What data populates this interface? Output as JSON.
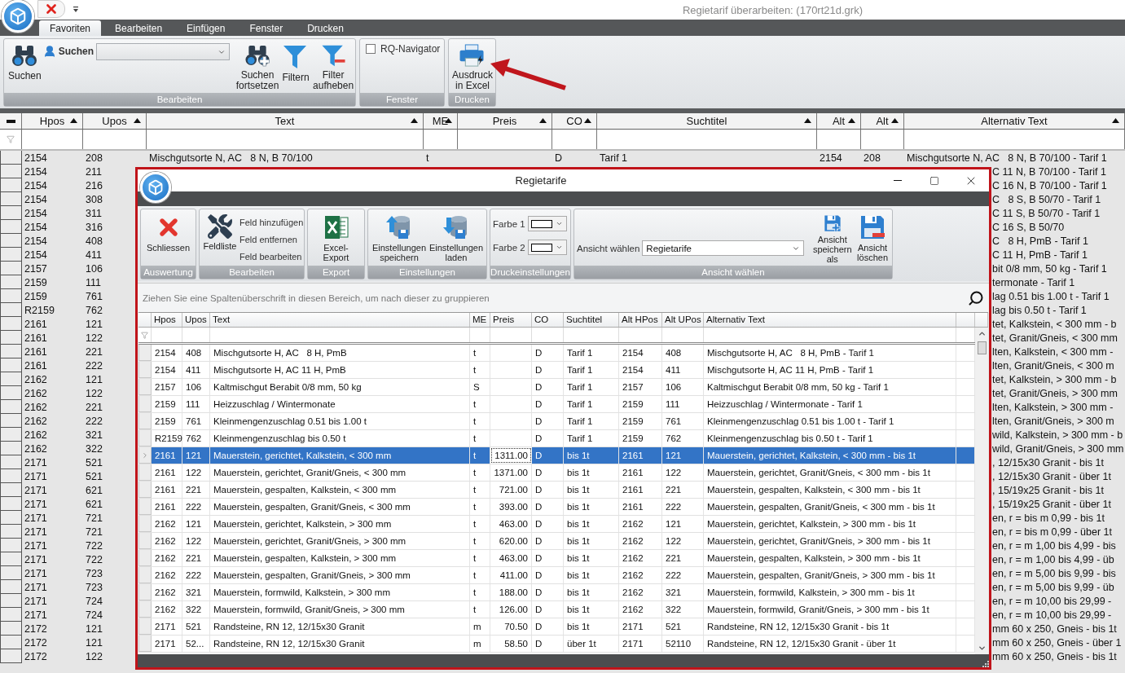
{
  "app": {
    "title": "Regietarif überarbeiten:  (170rt21d.grk)",
    "tabs": [
      {
        "label": "Favoriten",
        "selected": true
      },
      {
        "label": "Bearbeiten",
        "selected": false
      },
      {
        "label": "Einfügen",
        "selected": false
      },
      {
        "label": "Fenster",
        "selected": false
      },
      {
        "label": "Drucken",
        "selected": false
      }
    ],
    "ribbon": {
      "bearbeiten": {
        "label": "Bearbeiten",
        "search_button": "Suchen",
        "search_label": "Suchen",
        "continue_button": "Suchen fortsetzen",
        "filter_button": "Filtern",
        "clear_filter_button": "Filter aufheben"
      },
      "fenster": {
        "label": "Fenster",
        "navigator": {
          "label": "RQ-Navigator",
          "checked": false
        }
      },
      "drucken": {
        "label": "Drucken",
        "excel_button": "Ausdruck in Excel"
      }
    }
  },
  "grid": {
    "columns": [
      "Hpos",
      "Upos",
      "Text",
      "ME",
      "Preis",
      "CO",
      "Suchtitel",
      "Alt",
      "Alt",
      "Alternativ Text"
    ],
    "rows": [
      {
        "kind": "full",
        "hpos": "2154",
        "upos": "208",
        "text": "Mischgutsorte N, AC   8 N, B 70/100",
        "me": "t",
        "co": "D",
        "suchtitel": "Tarif 1",
        "alt_hpos": "2154",
        "alt_upos": "208",
        "alt_text": "Mischgutsorte N, AC   8 N, B 70/100 - Tarif 1"
      },
      {
        "kind": "covered",
        "hpos": "2154",
        "upos": "211",
        "alt_text": "C 11 N, B 70/100 - Tarif 1"
      },
      {
        "kind": "covered",
        "hpos": "2154",
        "upos": "216",
        "alt_text": "C 16 N, B 70/100 - Tarif 1"
      },
      {
        "kind": "covered",
        "hpos": "2154",
        "upos": "308",
        "alt_text": "C   8 S, B 50/70 - Tarif 1"
      },
      {
        "kind": "covered",
        "hpos": "2154",
        "upos": "311",
        "alt_text": "C 11 S, B 50/70 - Tarif 1"
      },
      {
        "kind": "covered",
        "hpos": "2154",
        "upos": "316",
        "alt_text": "C 16 S, B 50/70"
      },
      {
        "kind": "covered",
        "hpos": "2154",
        "upos": "408",
        "alt_text": "C   8 H, PmB - Tarif 1"
      },
      {
        "kind": "covered",
        "hpos": "2154",
        "upos": "411",
        "alt_text": "C 11 H, PmB - Tarif 1"
      },
      {
        "kind": "covered",
        "hpos": "2157",
        "upos": "106",
        "alt_text": "bit 0/8 mm, 50 kg - Tarif 1"
      },
      {
        "kind": "covered",
        "hpos": "2159",
        "upos": "111",
        "alt_text": "termonate - Tarif 1"
      },
      {
        "kind": "covered",
        "hpos": "2159",
        "upos": "761",
        "alt_text": "lag 0.51 bis 1.00 t - Tarif 1"
      },
      {
        "kind": "covered",
        "hpos": "R2159",
        "upos": "762",
        "alt_text": "lag bis 0.50 t - Tarif 1"
      },
      {
        "kind": "covered",
        "hpos": "2161",
        "upos": "121",
        "alt_text": "tet, Kalkstein, < 300 mm - b"
      },
      {
        "kind": "covered",
        "hpos": "2161",
        "upos": "122",
        "alt_text": "tet, Granit/Gneis, < 300 mm"
      },
      {
        "kind": "covered",
        "hpos": "2161",
        "upos": "221",
        "alt_text": "lten, Kalkstein, < 300 mm -"
      },
      {
        "kind": "covered",
        "hpos": "2161",
        "upos": "222",
        "alt_text": "lten, Granit/Gneis, < 300 m"
      },
      {
        "kind": "covered",
        "hpos": "2162",
        "upos": "121",
        "alt_text": "tet, Kalkstein, > 300 mm - b"
      },
      {
        "kind": "covered",
        "hpos": "2162",
        "upos": "122",
        "alt_text": "tet, Granit/Gneis, > 300 mm"
      },
      {
        "kind": "covered",
        "hpos": "2162",
        "upos": "221",
        "alt_text": "lten, Kalkstein, > 300 mm -"
      },
      {
        "kind": "covered",
        "hpos": "2162",
        "upos": "222",
        "alt_text": "lten, Granit/Gneis, > 300 m"
      },
      {
        "kind": "covered",
        "hpos": "2162",
        "upos": "321",
        "alt_text": "wild, Kalkstein, > 300 mm - b"
      },
      {
        "kind": "covered",
        "hpos": "2162",
        "upos": "322",
        "alt_text": "wild, Granit/Gneis, > 300 mm"
      },
      {
        "kind": "covered",
        "hpos": "2171",
        "upos": "521",
        "alt_text": ", 12/15x30 Granit - bis 1t"
      },
      {
        "kind": "covered",
        "hpos": "2171",
        "upos": "521",
        "alt_text": ", 12/15x30 Granit - über 1t"
      },
      {
        "kind": "covered",
        "hpos": "2171",
        "upos": "621",
        "alt_text": ", 15/19x25 Granit - bis 1t"
      },
      {
        "kind": "covered",
        "hpos": "2171",
        "upos": "621",
        "alt_text": ", 15/19x25 Granit - über 1t"
      },
      {
        "kind": "covered",
        "hpos": "2171",
        "upos": "721",
        "alt_text": "en, r = bis m 0,99 - bis 1t"
      },
      {
        "kind": "covered",
        "hpos": "2171",
        "upos": "721",
        "alt_text": "en, r = bis m 0,99 - über 1t"
      },
      {
        "kind": "covered",
        "hpos": "2171",
        "upos": "722",
        "alt_text": "en, r = m 1,00 bis 4,99 - bis"
      },
      {
        "kind": "covered",
        "hpos": "2171",
        "upos": "722",
        "alt_text": "en, r = m 1,00 bis 4,99 - üb"
      },
      {
        "kind": "covered",
        "hpos": "2171",
        "upos": "723",
        "alt_text": "en, r = m 5,00 bis 9,99 - bis"
      },
      {
        "kind": "covered",
        "hpos": "2171",
        "upos": "723",
        "alt_text": "en, r = m 5,00 bis 9,99 - üb"
      },
      {
        "kind": "covered",
        "hpos": "2171",
        "upos": "724",
        "alt_text": "en, r = m 10,00 bis 29,99 -"
      },
      {
        "kind": "covered",
        "hpos": "2171",
        "upos": "724",
        "alt_text": "en, r = m 10,00 bis 29,99 -"
      },
      {
        "kind": "covered",
        "hpos": "2172",
        "upos": "121",
        "alt_text": "mm 60 x 250, Gneis - bis 1t"
      },
      {
        "kind": "covered",
        "hpos": "2172",
        "upos": "121",
        "alt_text": "mm 60 x 250, Gneis - über 1"
      },
      {
        "kind": "covered",
        "hpos": "2172",
        "upos": "122",
        "alt_text": "mm 60 x 250, Gneis - bis 1t"
      }
    ]
  },
  "window": {
    "title": "Regietarife",
    "ribbon": {
      "auswertung": {
        "label": "Auswertung",
        "close_button": "Schliessen"
      },
      "bearbeiten": {
        "label": "Bearbeiten",
        "fields_button": "Feldliste",
        "items": [
          "Feld hinzufügen",
          "Feld entfernen",
          "Feld bearbeiten"
        ]
      },
      "export": {
        "label": "Export",
        "excel_button": "Excel-Export"
      },
      "einstellungen": {
        "label": "Einstellungen",
        "save_button": "Einstellungen speichern",
        "load_button": "Einstellungen laden"
      },
      "druck": {
        "label": "Druckeinstellungen",
        "colors": [
          "Farbe 1",
          "Farbe 2"
        ]
      },
      "ansicht": {
        "label": "Ansicht wählen",
        "view_label": "Ansicht wählen",
        "view_value": "Regietarife",
        "save_as_button": "Ansicht speichern als",
        "delete_button": "Ansicht löschen"
      }
    },
    "group_hint": "Ziehen Sie eine Spaltenüberschrift in diesen Bereich, um nach dieser zu gruppieren",
    "columns": [
      "Hpos",
      "Upos",
      "Text",
      "ME",
      "Preis",
      "CO",
      "Suchtitel",
      "Alt HPos",
      "Alt UPos",
      "Alternativ Text"
    ],
    "rows": [
      {
        "hpos": "2154",
        "upos": "408",
        "text": "Mischgutsorte H, AC   8 H, PmB",
        "me": "t",
        "co": "D",
        "suchtitel": "Tarif 1",
        "alt_hpos": "2154",
        "alt_upos": "408",
        "alt_text": "Mischgutsorte H, AC   8 H, PmB - Tarif 1",
        "selected": false
      },
      {
        "hpos": "2154",
        "upos": "411",
        "text": "Mischgutsorte H, AC 11 H, PmB",
        "me": "t",
        "co": "D",
        "suchtitel": "Tarif 1",
        "alt_hpos": "2154",
        "alt_upos": "411",
        "alt_text": "Mischgutsorte H, AC 11 H, PmB - Tarif 1",
        "selected": false
      },
      {
        "hpos": "2157",
        "upos": "106",
        "text": "Kaltmischgut Berabit 0/8 mm, 50 kg",
        "me": "S",
        "co": "D",
        "suchtitel": "Tarif 1",
        "alt_hpos": "2157",
        "alt_upos": "106",
        "alt_text": "Kaltmischgut Berabit 0/8 mm, 50 kg - Tarif 1",
        "selected": false
      },
      {
        "hpos": "2159",
        "upos": "111",
        "text": "Heizzuschlag / Wintermonate",
        "me": "t",
        "co": "D",
        "suchtitel": "Tarif 1",
        "alt_hpos": "2159",
        "alt_upos": "111",
        "alt_text": "Heizzuschlag / Wintermonate - Tarif 1",
        "selected": false
      },
      {
        "hpos": "2159",
        "upos": "761",
        "text": "Kleinmengenzuschlag 0.51 bis 1.00 t",
        "me": "t",
        "co": "D",
        "suchtitel": "Tarif 1",
        "alt_hpos": "2159",
        "alt_upos": "761",
        "alt_text": "Kleinmengenzuschlag 0.51 bis 1.00 t - Tarif 1",
        "selected": false
      },
      {
        "hpos": "R2159",
        "upos": "762",
        "text": "Kleinmengenzuschlag bis 0.50 t",
        "me": "t",
        "co": "D",
        "suchtitel": "Tarif 1",
        "alt_hpos": "2159",
        "alt_upos": "762",
        "alt_text": "Kleinmengenzuschlag bis 0.50 t - Tarif 1",
        "selected": false
      },
      {
        "hpos": "2161",
        "upos": "121",
        "text": "Mauerstein, gerichtet, Kalkstein, < 300 mm",
        "me": "t",
        "preis": "1311.00",
        "co": "D",
        "suchtitel": "bis 1t",
        "alt_hpos": "2161",
        "alt_upos": "121",
        "alt_text": "Mauerstein, gerichtet, Kalkstein, < 300 mm - bis 1t",
        "selected": true
      },
      {
        "hpos": "2161",
        "upos": "122",
        "text": "Mauerstein, gerichtet, Granit/Gneis, < 300 mm",
        "me": "t",
        "preis": "1371.00",
        "co": "D",
        "suchtitel": "bis 1t",
        "alt_hpos": "2161",
        "alt_upos": "122",
        "alt_text": "Mauerstein, gerichtet, Granit/Gneis, < 300 mm - bis 1t",
        "selected": false
      },
      {
        "hpos": "2161",
        "upos": "221",
        "text": "Mauerstein, gespalten, Kalkstein, < 300 mm",
        "me": "t",
        "preis": "721.00",
        "co": "D",
        "suchtitel": "bis 1t",
        "alt_hpos": "2161",
        "alt_upos": "221",
        "alt_text": "Mauerstein, gespalten, Kalkstein, < 300 mm - bis 1t",
        "selected": false
      },
      {
        "hpos": "2161",
        "upos": "222",
        "text": "Mauerstein, gespalten, Granit/Gneis, < 300 mm",
        "me": "t",
        "preis": "393.00",
        "co": "D",
        "suchtitel": "bis 1t",
        "alt_hpos": "2161",
        "alt_upos": "222",
        "alt_text": "Mauerstein, gespalten, Granit/Gneis, < 300 mm - bis 1t",
        "selected": false
      },
      {
        "hpos": "2162",
        "upos": "121",
        "text": "Mauerstein, gerichtet, Kalkstein, > 300 mm",
        "me": "t",
        "preis": "463.00",
        "co": "D",
        "suchtitel": "bis 1t",
        "alt_hpos": "2162",
        "alt_upos": "121",
        "alt_text": "Mauerstein, gerichtet, Kalkstein, > 300 mm - bis 1t",
        "selected": false
      },
      {
        "hpos": "2162",
        "upos": "122",
        "text": "Mauerstein, gerichtet, Granit/Gneis, > 300 mm",
        "me": "t",
        "preis": "620.00",
        "co": "D",
        "suchtitel": "bis 1t",
        "alt_hpos": "2162",
        "alt_upos": "122",
        "alt_text": "Mauerstein, gerichtet, Granit/Gneis, > 300 mm - bis 1t",
        "selected": false
      },
      {
        "hpos": "2162",
        "upos": "221",
        "text": "Mauerstein, gespalten, Kalkstein, > 300 mm",
        "me": "t",
        "preis": "463.00",
        "co": "D",
        "suchtitel": "bis 1t",
        "alt_hpos": "2162",
        "alt_upos": "221",
        "alt_text": "Mauerstein, gespalten, Kalkstein, > 300 mm - bis 1t",
        "selected": false
      },
      {
        "hpos": "2162",
        "upos": "222",
        "text": "Mauerstein, gespalten, Granit/Gneis, > 300 mm",
        "me": "t",
        "preis": "411.00",
        "co": "D",
        "suchtitel": "bis 1t",
        "alt_hpos": "2162",
        "alt_upos": "222",
        "alt_text": "Mauerstein, gespalten, Granit/Gneis, > 300 mm - bis 1t",
        "selected": false
      },
      {
        "hpos": "2162",
        "upos": "321",
        "text": "Mauerstein, formwild, Kalkstein, > 300 mm",
        "me": "t",
        "preis": "188.00",
        "co": "D",
        "suchtitel": "bis 1t",
        "alt_hpos": "2162",
        "alt_upos": "321",
        "alt_text": "Mauerstein, formwild, Kalkstein, > 300 mm - bis 1t",
        "selected": false
      },
      {
        "hpos": "2162",
        "upos": "322",
        "text": "Mauerstein, formwild, Granit/Gneis, > 300 mm",
        "me": "t",
        "preis": "126.00",
        "co": "D",
        "suchtitel": "bis 1t",
        "alt_hpos": "2162",
        "alt_upos": "322",
        "alt_text": "Mauerstein, formwild, Granit/Gneis, > 300 mm - bis 1t",
        "selected": false
      },
      {
        "hpos": "2171",
        "upos": "521",
        "text": "Randsteine, RN 12, 12/15x30 Granit",
        "me": "m",
        "preis": "70.50",
        "co": "D",
        "suchtitel": "bis 1t",
        "alt_hpos": "2171",
        "alt_upos": "521",
        "alt_text": "Randsteine, RN 12, 12/15x30 Granit - bis 1t",
        "selected": false
      },
      {
        "hpos": "2171",
        "upos": "52...",
        "text": "Randsteine, RN 12, 12/15x30 Granit",
        "me": "m",
        "preis": "58.50",
        "co": "D",
        "suchtitel": "über 1t",
        "alt_hpos": "2171",
        "alt_upos": "52110",
        "alt_text": "Randsteine, RN 12, 12/15x30 Granit - über 1t",
        "selected": false
      }
    ]
  }
}
